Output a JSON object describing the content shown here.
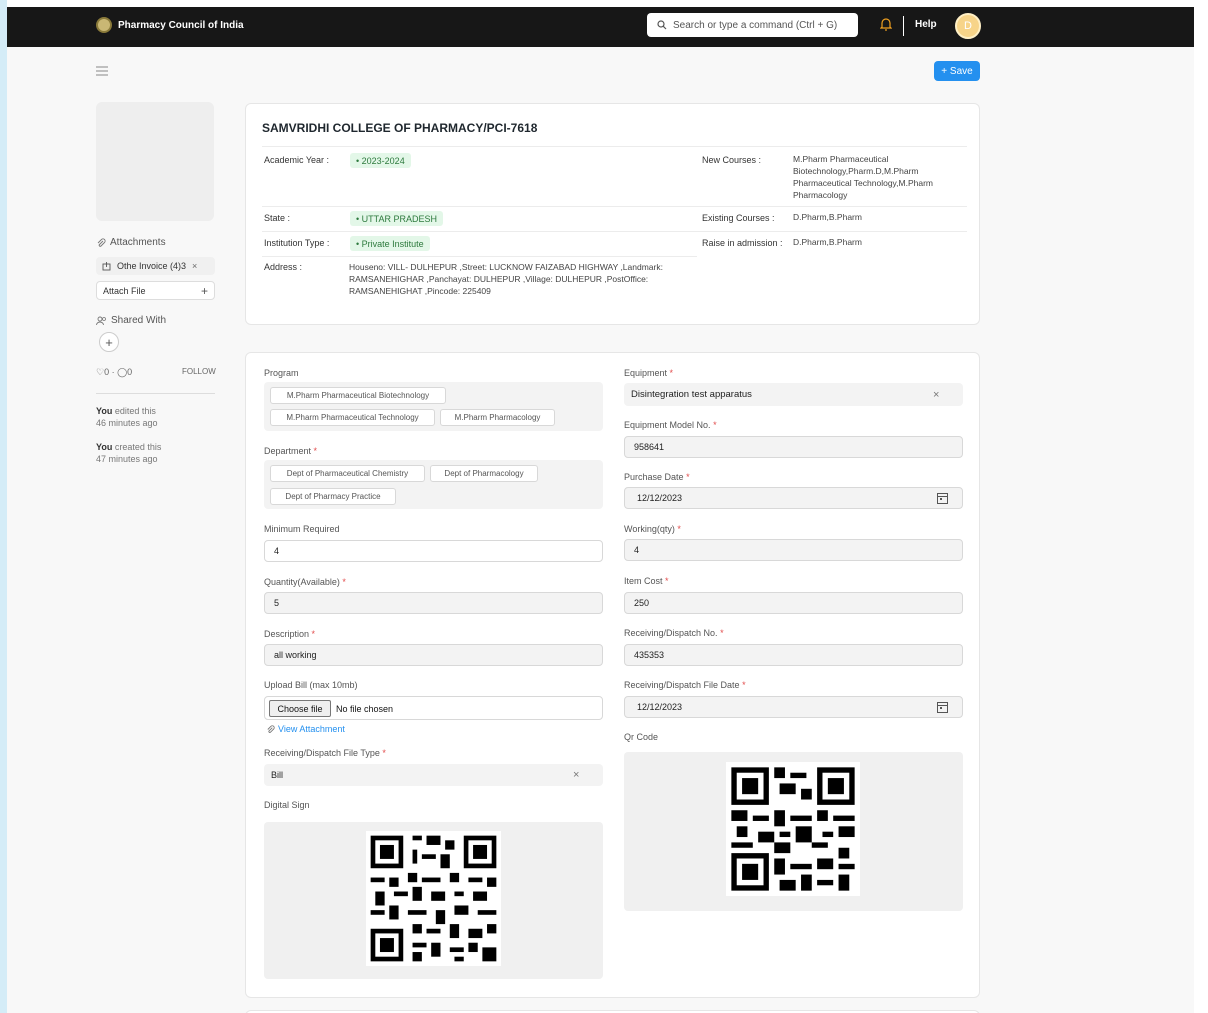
{
  "navbar": {
    "brand": "Pharmacy Council of India",
    "search_placeholder": "Search or type a command (Ctrl + G)",
    "help": "Help",
    "avatar_initial": "D"
  },
  "toolbar": {
    "save_label": "+ Save"
  },
  "sidebar": {
    "attachments_label": "Attachments",
    "attachment_file": "Othe Invoice (4)3",
    "attach_file_label": "Attach File",
    "shared_with_label": "Shared With",
    "likes_comments": "♡0 · ◯0",
    "follow_label": "FOLLOW",
    "activity": [
      {
        "who": "You",
        "action": " edited this",
        "when": "46 minutes ago"
      },
      {
        "who": "You",
        "action": " created this",
        "when": "47 minutes ago"
      }
    ]
  },
  "document": {
    "title": "SAMVRIDHI COLLEGE OF PHARMACY/PCI-7618",
    "fields": {
      "academic_year_label": "Academic Year :",
      "academic_year_value": "2023-2024",
      "state_label": "State :",
      "state_value": "UTTAR PRADESH",
      "institution_type_label": "Institution Type :",
      "institution_type_value": "Private Institute",
      "address_label": "Address :",
      "address_value": "Houseno: VILL- DULHEPUR ,Street: LUCKNOW FAIZABAD HIGHWAY ,Landmark: RAMSANEHIGHAR ,Panchayat: DULHEPUR ,Village: DULHEPUR ,PostOffice: RAMSANEHIGHAT ,Pincode: 225409",
      "new_courses_label": "New Courses :",
      "new_courses_value": "M.Pharm Pharmaceutical Biotechnology,Pharm.D,M.Pharm Pharmaceutical Technology,M.Pharm Pharmacology",
      "existing_courses_label": "Existing Courses :",
      "existing_courses_value": "D.Pharm,B.Pharm",
      "raise_admission_label": "Raise in admission :",
      "raise_admission_value": "D.Pharm,B.Pharm"
    }
  },
  "form": {
    "program_label": "Program",
    "programs": [
      "M.Pharm Pharmaceutical Biotechnology",
      "M.Pharm Pharmaceutical Technology",
      "M.Pharm Pharmacology"
    ],
    "department_label": "Department",
    "departments": [
      "Dept of Pharmaceutical Chemistry",
      "Dept of Pharmacology",
      "Dept of Pharmacy Practice"
    ],
    "min_required_label": "Minimum Required",
    "min_required_value": "4",
    "qty_available_label": "Quantity(Available)",
    "qty_available_value": "5",
    "description_label": "Description",
    "description_value": "all working",
    "upload_bill_label": "Upload Bill (max 10mb)",
    "choose_file": "Choose file",
    "no_file": "No file chosen",
    "view_attachment": "View Attachment",
    "dispatch_file_type_label": "Receiving/Dispatch File Type",
    "dispatch_file_type_value": "Bill",
    "digital_sign_label": "Digital Sign",
    "equipment_label": "Equipment",
    "equipment_value": "Disintegration test apparatus",
    "equipment_model_label": "Equipment Model No.",
    "equipment_model_value": "958641",
    "purchase_date_label": "Purchase Date",
    "purchase_date_value": "12/12/2023",
    "working_qty_label": "Working(qty)",
    "working_qty_value": "4",
    "item_cost_label": "Item Cost",
    "item_cost_value": "250",
    "dispatch_no_label": "Receiving/Dispatch No.",
    "dispatch_no_value": "435353",
    "dispatch_date_label": "Receiving/Dispatch File Date",
    "dispatch_date_value": "12/12/2023",
    "qr_code_label": "Qr Code",
    "required_mark": "*"
  },
  "colors": {
    "navbar": "#171717",
    "primary": "#2490ef",
    "tag_bg": "#e3f7e8",
    "required": "#e24c4c"
  }
}
